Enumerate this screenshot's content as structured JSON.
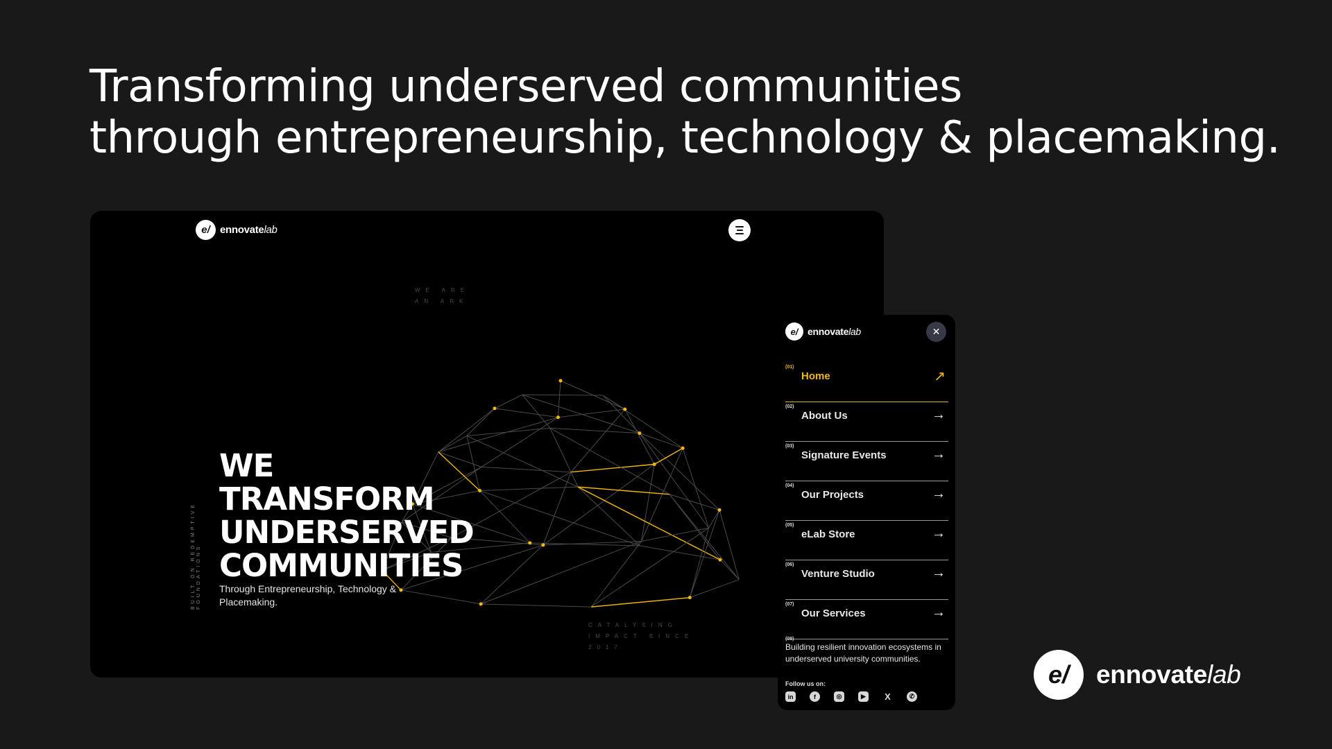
{
  "headline": {
    "line1": "Transforming underserved communities",
    "line2": "through entrepreneurship, technology & placemaking."
  },
  "brand": {
    "mark": "e/",
    "word_bold": "ennovate",
    "word_light": "lab"
  },
  "desktop": {
    "we_are": "WE ARE AN ARK",
    "side_text": "BUILT ON REDEMPTIVE FOUNDATIONS",
    "title_lines": [
      "WE",
      "TRANSFORM",
      "UNDERSERVED",
      "COMMUNITIES"
    ],
    "subtitle": "Through Entrepreneurship, Technology & Placemaking.",
    "catalysing": "CATALYSING IMPACT SINCE 2017"
  },
  "mobile_menu": {
    "close_icon": "close-icon",
    "items": [
      {
        "num": "(01)",
        "label": "Home",
        "active": true
      },
      {
        "num": "(02)",
        "label": "About Us"
      },
      {
        "num": "(03)",
        "label": "Signature Events"
      },
      {
        "num": "(04)",
        "label": "Our Projects"
      },
      {
        "num": "(05)",
        "label": "eLab Store"
      },
      {
        "num": "(06)",
        "label": "Venture Studio"
      },
      {
        "num": "(07)",
        "label": "Our Services"
      }
    ],
    "extra_num": "(08)",
    "description": "Building resilient innovation ecosystems in underserved university communities.",
    "follow_label": "Follow us on:",
    "socials": [
      "linkedin-icon",
      "facebook-icon",
      "instagram-icon",
      "youtube-icon",
      "x-icon",
      "whatsapp-icon"
    ]
  },
  "colors": {
    "background": "#191919",
    "accent": "#f2b90c",
    "panel": "#000000"
  }
}
